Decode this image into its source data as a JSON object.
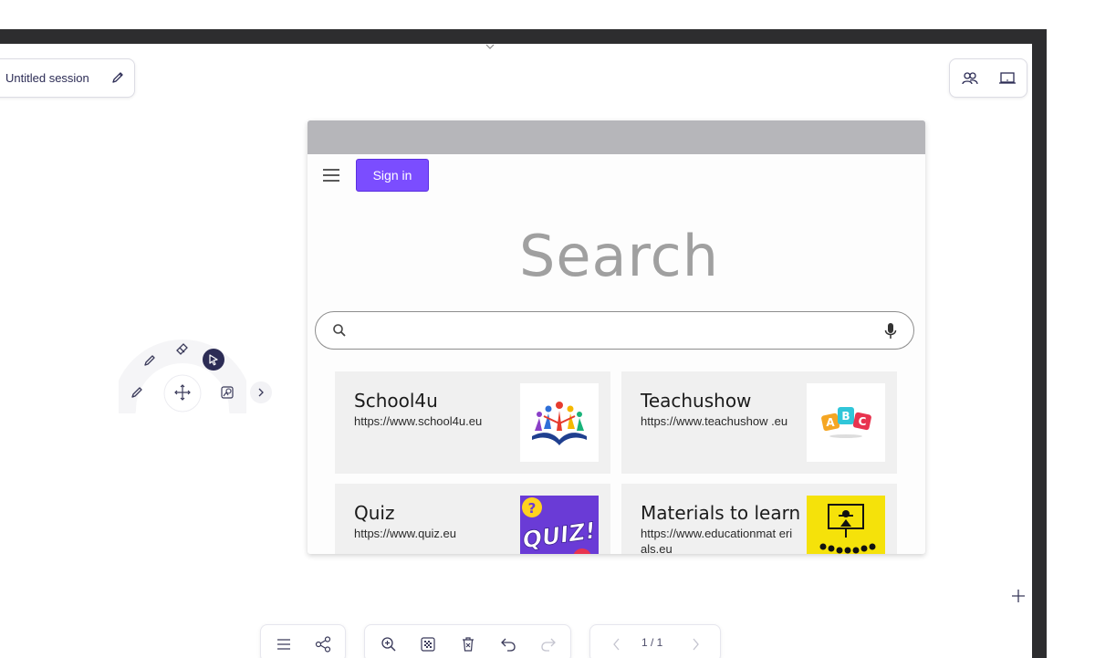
{
  "session": {
    "title": "Untitled session"
  },
  "browser": {
    "signin_label": "Sign in",
    "search_heading": "Search",
    "search_placeholder": "",
    "tiles": [
      {
        "name": "School4u",
        "url": "https://www.school4u.eu"
      },
      {
        "name": "Teachushow",
        "url": "https://www.teachushow .eu"
      },
      {
        "name": "Quiz",
        "url": "https://www.quiz.eu"
      },
      {
        "name": "Materials to learn",
        "url": "https://www.educationmat erials.eu"
      }
    ],
    "quiz_badge": "QUIZ!",
    "quiz_mark": "?",
    "abc": [
      "A",
      "B",
      "C"
    ]
  },
  "toolbar": {
    "page_indicator": "1 / 1"
  },
  "colors": {
    "accent": "#7b4dff",
    "navy": "#2c2c55",
    "frame": "#2d2d2f",
    "quiz_purple": "#6a3bd6",
    "quiz_yellow": "#ffd21f",
    "materials_yellow": "#f5e20a"
  },
  "icons": [
    "edit-icon",
    "participants-icon",
    "screen-icon",
    "hamburger-icon",
    "search-icon",
    "mic-icon",
    "pen-icon",
    "eraser-icon",
    "select-cursor-icon",
    "pencil-icon",
    "move-icon",
    "shape-icon",
    "chevron-right-icon",
    "menu-icon",
    "share-icon",
    "zoom-in-icon",
    "background-grid-icon",
    "delete-icon",
    "undo-icon",
    "redo-icon",
    "prev-page-icon",
    "next-page-icon",
    "plus-icon"
  ]
}
